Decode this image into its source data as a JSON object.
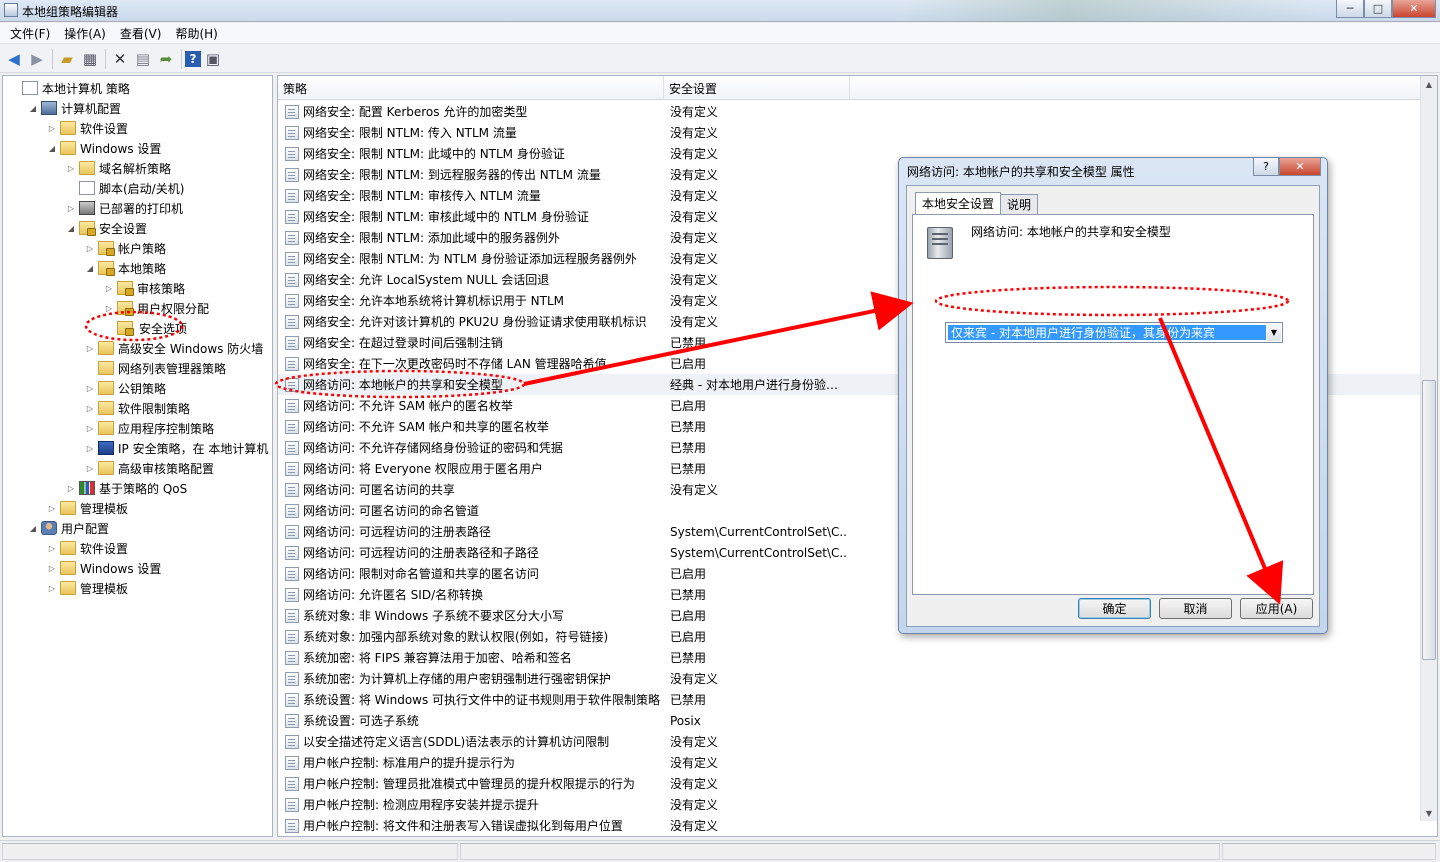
{
  "window": {
    "title": "本地组策略编辑器",
    "controls": {
      "minimize": "─",
      "maximize": "□",
      "close": "✕"
    }
  },
  "menu": [
    "文件(F)",
    "操作(A)",
    "查看(V)",
    "帮助(H)"
  ],
  "toolbar": [
    "back-icon",
    "forward-icon",
    "up-folder-icon",
    "show-hide-tree-icon",
    "delete-icon",
    "properties-icon",
    "export-icon",
    "help-icon",
    "console-icon"
  ],
  "tree": [
    {
      "label": "本地计算机 策略",
      "indent": 0,
      "toggle": "",
      "icon": "doc"
    },
    {
      "label": "计算机配置",
      "indent": 1,
      "toggle": "◢",
      "icon": "computer"
    },
    {
      "label": "软件设置",
      "indent": 2,
      "toggle": "▷",
      "icon": "folder"
    },
    {
      "label": "Windows 设置",
      "indent": 2,
      "toggle": "◢",
      "icon": "folder"
    },
    {
      "label": "域名解析策略",
      "indent": 3,
      "toggle": "▷",
      "icon": "folder"
    },
    {
      "label": "脚本(启动/关机)",
      "indent": 3,
      "toggle": "",
      "icon": "doc"
    },
    {
      "label": "已部署的打印机",
      "indent": 3,
      "toggle": "▷",
      "icon": "printer"
    },
    {
      "label": "安全设置",
      "indent": 3,
      "toggle": "◢",
      "icon": "folder-lock"
    },
    {
      "label": "帐户策略",
      "indent": 4,
      "toggle": "▷",
      "icon": "folder-lock"
    },
    {
      "label": "本地策略",
      "indent": 4,
      "toggle": "◢",
      "icon": "folder-lock"
    },
    {
      "label": "审核策略",
      "indent": 5,
      "toggle": "▷",
      "icon": "folder-lock"
    },
    {
      "label": "用户权限分配",
      "indent": 5,
      "toggle": "▷",
      "icon": "folder-lock"
    },
    {
      "label": "安全选项",
      "indent": 5,
      "toggle": "",
      "icon": "folder-lock",
      "selected": true
    },
    {
      "label": "高级安全 Windows 防火墙",
      "indent": 4,
      "toggle": "▷",
      "icon": "folder"
    },
    {
      "label": "网络列表管理器策略",
      "indent": 4,
      "toggle": "",
      "icon": "folder"
    },
    {
      "label": "公钥策略",
      "indent": 4,
      "toggle": "▷",
      "icon": "folder"
    },
    {
      "label": "软件限制策略",
      "indent": 4,
      "toggle": "▷",
      "icon": "folder"
    },
    {
      "label": "应用程序控制策略",
      "indent": 4,
      "toggle": "▷",
      "icon": "folder"
    },
    {
      "label": "IP 安全策略，在 本地计算机",
      "indent": 4,
      "toggle": "▷",
      "icon": "shield"
    },
    {
      "label": "高级审核策略配置",
      "indent": 4,
      "toggle": "▷",
      "icon": "folder"
    },
    {
      "label": "基于策略的 QoS",
      "indent": 3,
      "toggle": "▷",
      "icon": "chart"
    },
    {
      "label": "管理模板",
      "indent": 2,
      "toggle": "▷",
      "icon": "folder"
    },
    {
      "label": "用户配置",
      "indent": 1,
      "toggle": "◢",
      "icon": "user"
    },
    {
      "label": "软件设置",
      "indent": 2,
      "toggle": "▷",
      "icon": "folder"
    },
    {
      "label": "Windows 设置",
      "indent": 2,
      "toggle": "▷",
      "icon": "folder"
    },
    {
      "label": "管理模板",
      "indent": 2,
      "toggle": "▷",
      "icon": "folder"
    }
  ],
  "list": {
    "columns": [
      "策略",
      "安全设置"
    ],
    "rows": [
      {
        "policy": "网络安全: 配置 Kerberos 允许的加密类型",
        "setting": "没有定义"
      },
      {
        "policy": "网络安全: 限制 NTLM: 传入 NTLM 流量",
        "setting": "没有定义"
      },
      {
        "policy": "网络安全: 限制 NTLM: 此域中的 NTLM 身份验证",
        "setting": "没有定义"
      },
      {
        "policy": "网络安全: 限制 NTLM: 到远程服务器的传出 NTLM 流量",
        "setting": "没有定义"
      },
      {
        "policy": "网络安全: 限制 NTLM: 审核传入 NTLM 流量",
        "setting": "没有定义"
      },
      {
        "policy": "网络安全: 限制 NTLM: 审核此域中的 NTLM 身份验证",
        "setting": "没有定义"
      },
      {
        "policy": "网络安全: 限制 NTLM: 添加此域中的服务器例外",
        "setting": "没有定义"
      },
      {
        "policy": "网络安全: 限制 NTLM: 为 NTLM 身份验证添加远程服务器例外",
        "setting": "没有定义"
      },
      {
        "policy": "网络安全: 允许 LocalSystem NULL 会话回退",
        "setting": "没有定义"
      },
      {
        "policy": "网络安全: 允许本地系统将计算机标识用于 NTLM",
        "setting": "没有定义"
      },
      {
        "policy": "网络安全: 允许对该计算机的 PKU2U 身份验证请求使用联机标识",
        "setting": "没有定义"
      },
      {
        "policy": "网络安全: 在超过登录时间后强制注销",
        "setting": "已禁用"
      },
      {
        "policy": "网络安全: 在下一次更改密码时不存储 LAN 管理器哈希值",
        "setting": "已启用"
      },
      {
        "policy": "网络访问: 本地帐户的共享和安全模型",
        "setting": "经典 - 对本地用户进行身份验…",
        "highlighted": true
      },
      {
        "policy": "网络访问: 不允许 SAM 帐户的匿名枚举",
        "setting": "已启用"
      },
      {
        "policy": "网络访问: 不允许 SAM 帐户和共享的匿名枚举",
        "setting": "已禁用"
      },
      {
        "policy": "网络访问: 不允许存储网络身份验证的密码和凭据",
        "setting": "已禁用"
      },
      {
        "policy": "网络访问: 将 Everyone 权限应用于匿名用户",
        "setting": "已禁用"
      },
      {
        "policy": "网络访问: 可匿名访问的共享",
        "setting": "没有定义"
      },
      {
        "policy": "网络访问: 可匿名访问的命名管道",
        "setting": ""
      },
      {
        "policy": "网络访问: 可远程访问的注册表路径",
        "setting": "System\\CurrentControlSet\\C..."
      },
      {
        "policy": "网络访问: 可远程访问的注册表路径和子路径",
        "setting": "System\\CurrentControlSet\\C..."
      },
      {
        "policy": "网络访问: 限制对命名管道和共享的匿名访问",
        "setting": "已启用"
      },
      {
        "policy": "网络访问: 允许匿名 SID/名称转换",
        "setting": "已禁用"
      },
      {
        "policy": "系统对象: 非 Windows 子系统不要求区分大小写",
        "setting": "已启用"
      },
      {
        "policy": "系统对象: 加强内部系统对象的默认权限(例如，符号链接)",
        "setting": "已启用"
      },
      {
        "policy": "系统加密: 将 FIPS 兼容算法用于加密、哈希和签名",
        "setting": "已禁用"
      },
      {
        "policy": "系统加密: 为计算机上存储的用户密钥强制进行强密钥保护",
        "setting": "没有定义"
      },
      {
        "policy": "系统设置: 将 Windows 可执行文件中的证书规则用于软件限制策略",
        "setting": "已禁用"
      },
      {
        "policy": "系统设置: 可选子系统",
        "setting": "Posix"
      },
      {
        "policy": "以安全描述符定义语言(SDDL)语法表示的计算机访问限制",
        "setting": "没有定义"
      },
      {
        "policy": "用户帐户控制: 标准用户的提升提示行为",
        "setting": "没有定义"
      },
      {
        "policy": "用户帐户控制: 管理员批准模式中管理员的提升权限提示的行为",
        "setting": "没有定义"
      },
      {
        "policy": "用户帐户控制: 检测应用程序安装并提示提升",
        "setting": "没有定义"
      },
      {
        "policy": "用户帐户控制: 将文件和注册表写入错误虚拟化到每用户位置",
        "setting": "没有定义"
      }
    ]
  },
  "dialog": {
    "title": "网络访问: 本地帐户的共享和安全模型 属性",
    "help_btn": "?",
    "close_btn": "✕",
    "tabs": [
      "本地安全设置",
      "说明"
    ],
    "heading": "网络访问: 本地帐户的共享和安全模型",
    "combo_value": "仅来宾 - 对本地用户进行身份验证，其身份为来宾",
    "buttons": {
      "ok": "确定",
      "cancel": "取消",
      "apply": "应用(A)"
    }
  },
  "annotation_color": "#ff0000"
}
